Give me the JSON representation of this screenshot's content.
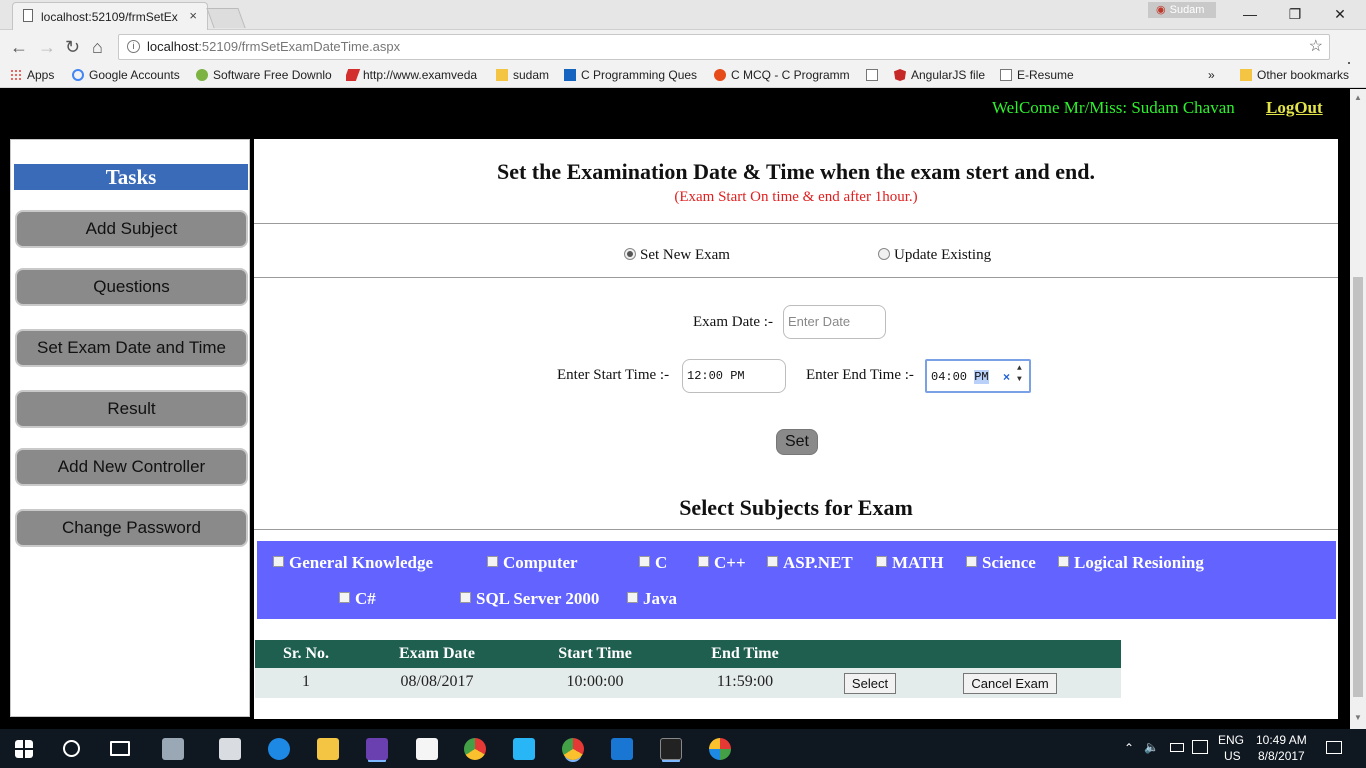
{
  "browser": {
    "tab_title": "localhost:52109/frmSetEx",
    "tab_close": "×",
    "user_chip": "Sudam",
    "window": {
      "minimize": "—",
      "maximize": "❐",
      "close": "✕"
    },
    "nav": {
      "back": "←",
      "forward": "→",
      "reload": "↻",
      "home": "⌂",
      "menu": "⋮"
    },
    "url_host": "localhost",
    "url_rest": ":52109/frmSetExamDateTime.aspx",
    "bookmark_star": "☆",
    "bookmarks": [
      {
        "label": "Apps",
        "color": "#e53935"
      },
      {
        "label": "Google Accounts",
        "color": "#4285f4"
      },
      {
        "label": "Software Free Downlo",
        "color": "#7cb342"
      },
      {
        "label": "http://www.examveda",
        "color": "#d32f2f"
      },
      {
        "label": "sudam",
        "color": "#f4c542"
      },
      {
        "label": "C Programming Ques",
        "color": "#1565c0"
      },
      {
        "label": "C MCQ - C Programm",
        "color": "#e64a19"
      },
      {
        "label": "",
        "color": "#777777"
      },
      {
        "label": "AngularJS file",
        "color": "#c62828"
      },
      {
        "label": "E-Resume",
        "color": "#777777"
      }
    ],
    "bookmarks_more": "»",
    "other_bookmarks": "Other bookmarks"
  },
  "header": {
    "welcome": "WelCome Mr/Miss: Sudam Chavan",
    "logout": "LogOut"
  },
  "sidebar": {
    "title": "Tasks",
    "items": [
      {
        "label": "Add Subject"
      },
      {
        "label": "Questions"
      },
      {
        "label": "Set Exam Date and Time"
      },
      {
        "label": "Result"
      },
      {
        "label": "Add New Controller"
      },
      {
        "label": "Change Password"
      }
    ]
  },
  "main": {
    "title": "Set the Examination Date & Time when the exam stert and end.",
    "subtitle": "(Exam Start On time & end after 1hour.)",
    "radio_new": "Set New Exam",
    "radio_update": "Update Existing",
    "exam_date_label": "Exam Date :-",
    "exam_date_placeholder": "Enter Date",
    "start_time_label": "Enter Start Time :-",
    "start_time_value": "12:00 PM",
    "end_time_label": "Enter End Time :-",
    "end_time_hour_min": "04:00",
    "end_time_ampm": "PM",
    "set_button": "Set",
    "subjects_title": "Select Subjects for Exam",
    "subjects": [
      "General Knowledge",
      "Computer",
      "C",
      "C++",
      "ASP.NET",
      "MATH",
      "Science",
      "Logical Resioning",
      "C#",
      "SQL Server 2000",
      "Java"
    ]
  },
  "grid": {
    "headers": [
      "Sr. No.",
      "Exam Date",
      "Start Time",
      "End Time"
    ],
    "rows": [
      {
        "sr": "1",
        "date": "08/08/2017",
        "start": "10:00:00",
        "end": "11:59:00",
        "select": "Select",
        "cancel": "Cancel Exam"
      }
    ]
  },
  "taskbar": {
    "lang": "ENG",
    "region": "US",
    "time": "10:49 AM",
    "date": "8/8/2017"
  }
}
